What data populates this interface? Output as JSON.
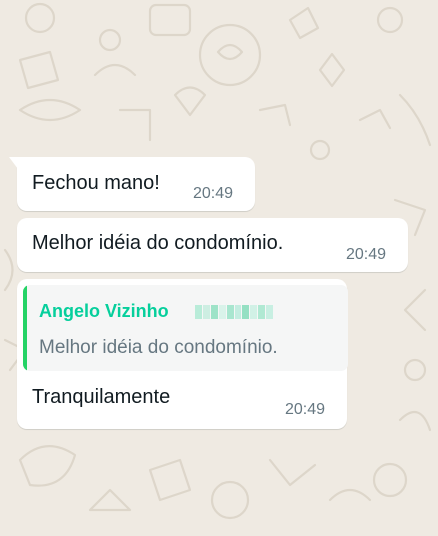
{
  "colors": {
    "wallpaper": "#efeae2",
    "bubble": "#ffffff",
    "quote_accent": "#25d366",
    "quote_author": "#06cf9c"
  },
  "messages": [
    {
      "text": "Fechou mano!",
      "time": "20:49"
    },
    {
      "text": "Melhor idéia do condomínio.",
      "time": "20:49"
    },
    {
      "quoted": {
        "author": "Angelo Vizinho",
        "text": "Melhor idéia do condomínio."
      },
      "text": "Tranquilamente",
      "time": "20:49"
    }
  ]
}
